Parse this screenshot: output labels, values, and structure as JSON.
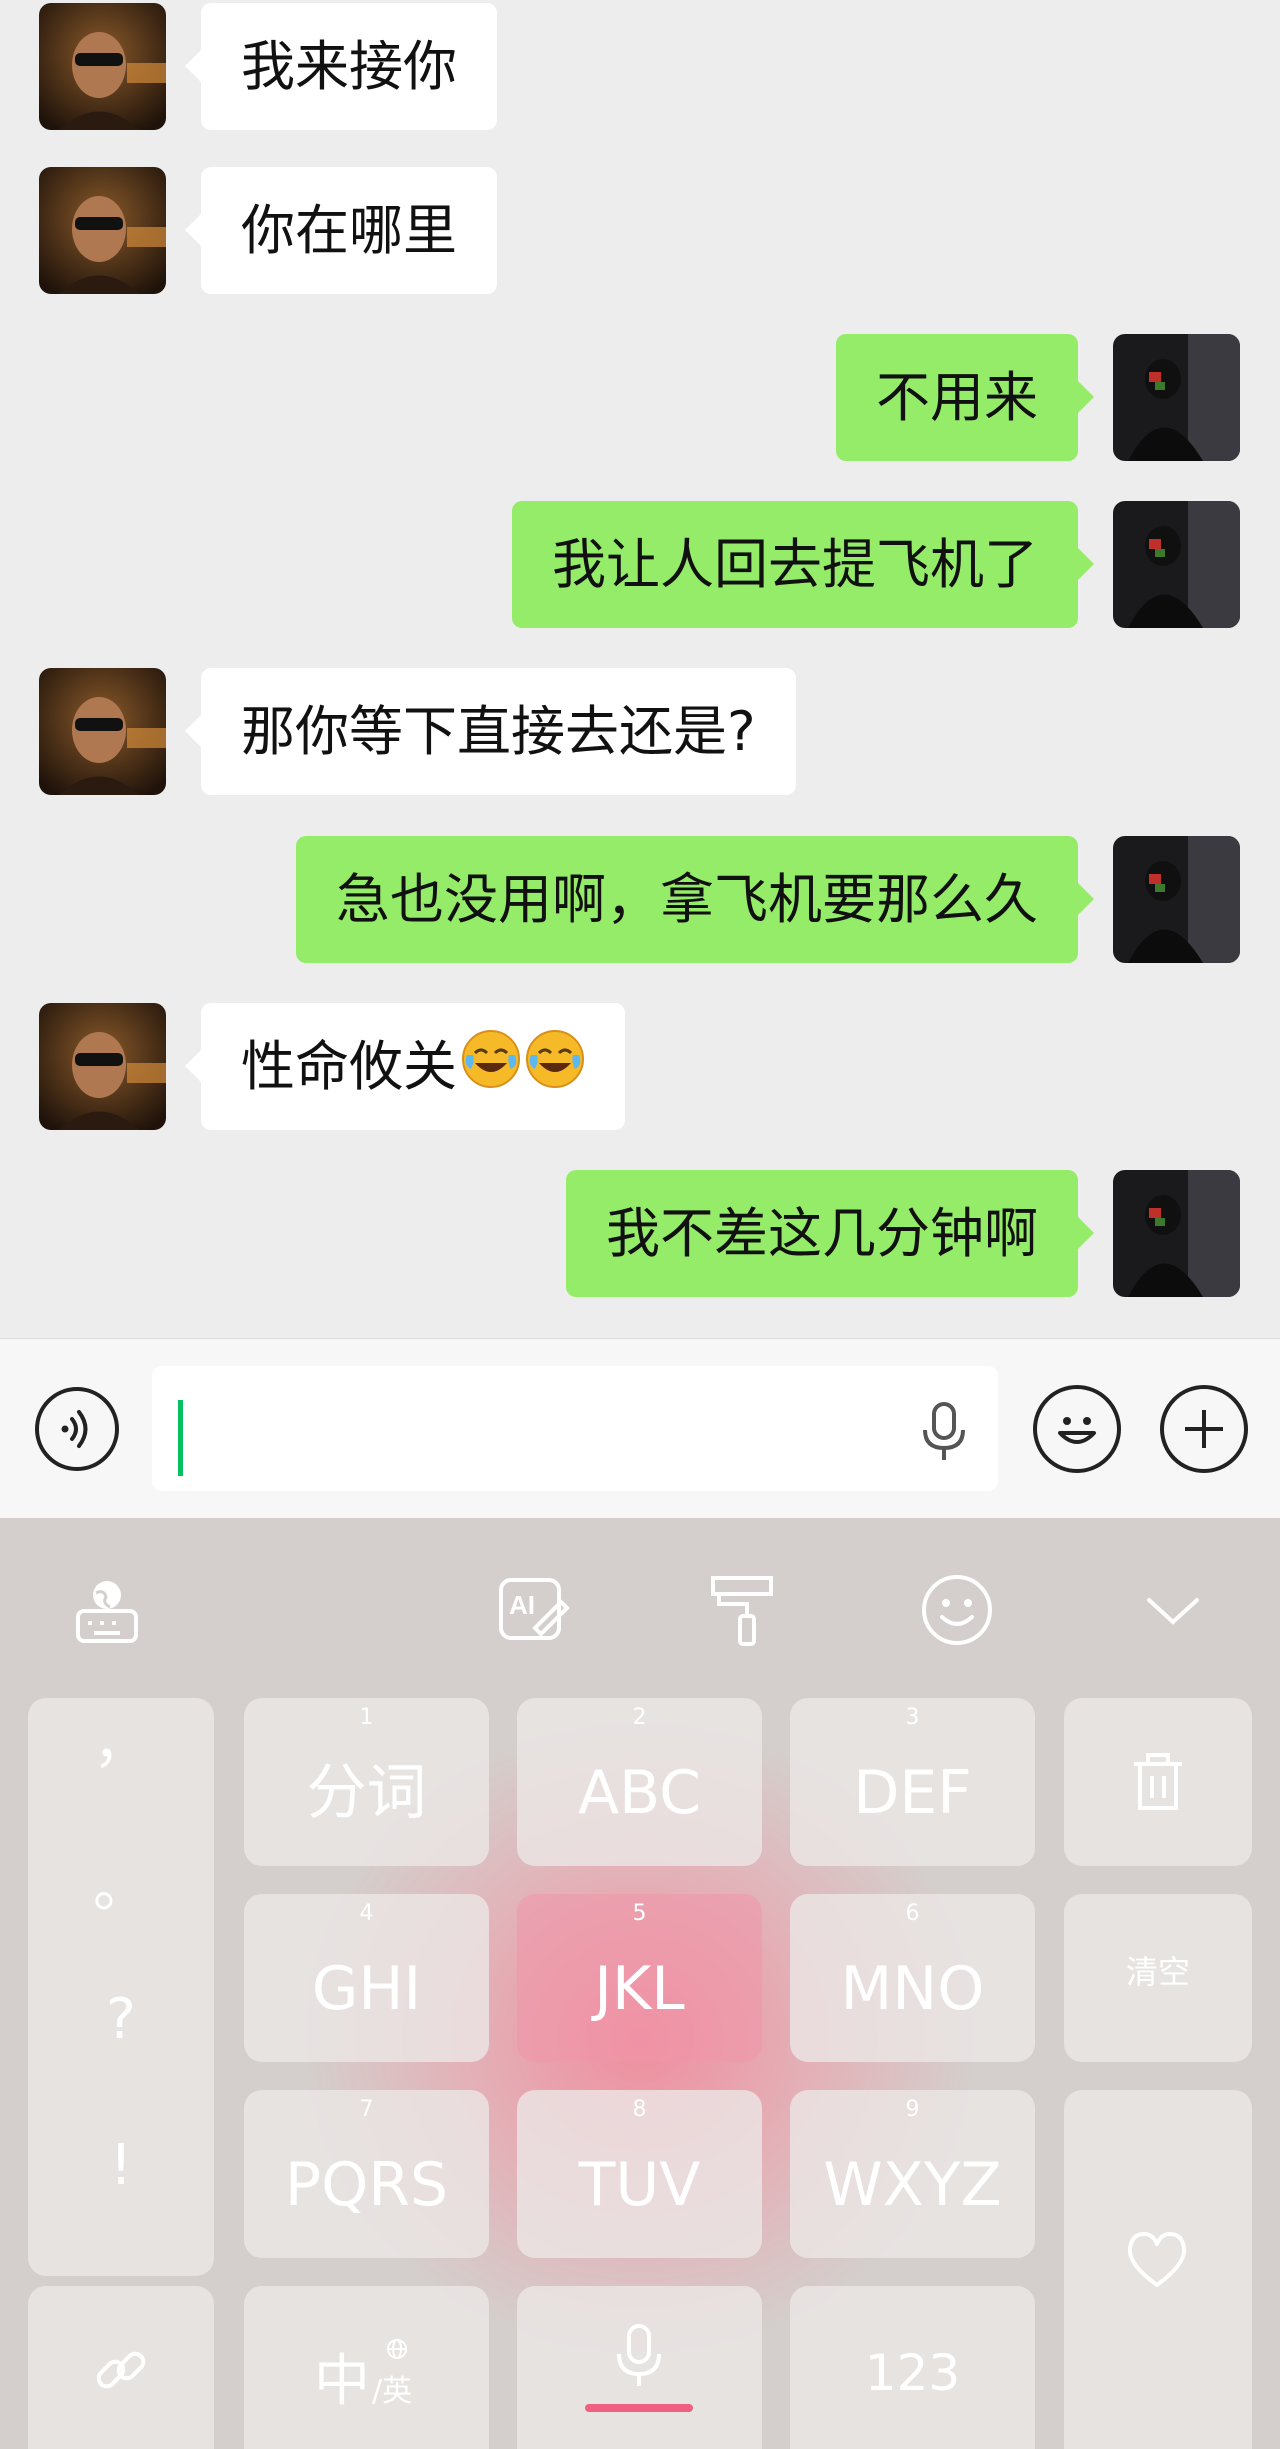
{
  "messages": [
    {
      "side": "left",
      "text": "我来接你"
    },
    {
      "side": "left",
      "text": "你在哪里"
    },
    {
      "side": "right",
      "text": "不用来"
    },
    {
      "side": "right",
      "text": "我让人回去提飞机了"
    },
    {
      "side": "left",
      "text": "那你等下直接去还是?"
    },
    {
      "side": "right",
      "text": "急也没用啊，拿飞机要那么久"
    },
    {
      "side": "left",
      "text": "性命攸关",
      "emoji": [
        "face-with-tears-of-joy-icon",
        "face-with-tears-of-joy-icon"
      ]
    },
    {
      "side": "right",
      "text": "我不差这几分钟啊"
    }
  ],
  "colors": {
    "chat_bg": "#ededed",
    "bubble_left": "#ffffff",
    "bubble_right": "#95ec69",
    "cursor": "#07c160",
    "keyboard_bg": "#d4cfcc",
    "keyboard_glow": "#f48296"
  },
  "keyboard": {
    "punctuation": [
      "，",
      "。",
      "?",
      "!"
    ],
    "keys": [
      {
        "num": "1",
        "label": "分词"
      },
      {
        "num": "2",
        "label": "ABC"
      },
      {
        "num": "3",
        "label": "DEF"
      },
      {
        "num": "4",
        "label": "GHI"
      },
      {
        "num": "5",
        "label": "JKL"
      },
      {
        "num": "6",
        "label": "MNO"
      },
      {
        "num": "7",
        "label": "PQRS"
      },
      {
        "num": "8",
        "label": "TUV"
      },
      {
        "num": "9",
        "label": "WXYZ"
      }
    ],
    "clear_label": "清空",
    "lang_main": "中",
    "lang_sub": "/英",
    "numbers_label": "123"
  }
}
